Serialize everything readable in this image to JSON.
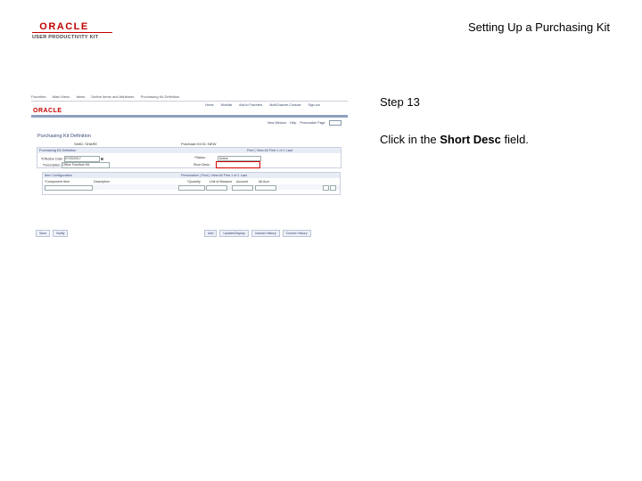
{
  "logo": {
    "brand": "ORACLE",
    "product": "USER PRODUCTIVITY KIT"
  },
  "document": {
    "title": "Setting Up a Purchasing Kit"
  },
  "step": {
    "label": "Step 13",
    "instruction_prefix": "Click in the ",
    "instruction_target": "Short Desc",
    "instruction_suffix": " field."
  },
  "app": {
    "breadcrumbs": [
      "Favorites",
      "Main Menu",
      "Items",
      "Define Items and Attributes",
      "Purchasing Kit Definition"
    ],
    "brand": "ORACLE",
    "top_nav": [
      "Home",
      "Worklist",
      "Add to Favorites",
      "MultiChannel Console",
      "Sign out"
    ],
    "new_window": "New Window",
    "help": "Help",
    "personalize": "Personalize Page",
    "page_title": "Purchasing Kit Definition",
    "setid_label": "SetID:",
    "setid_value": "SHARE",
    "kitid_label": "Purchase Kit ID:",
    "kitid_value": "NEW",
    "panel_title": "Purchasing Kit Definition",
    "panel_nav": "Find | View All   First 1 of 1 Last",
    "effdate_label": "*Effective Date:",
    "effdate_value": "07/03/2017",
    "status_label": "*Status:",
    "status_value": "Active",
    "desc_label": "*Description:",
    "desc_value": "Office Furniture Kit",
    "shortdesc_label": "Short Desc:",
    "grid_title": "Item Configuration",
    "grid_nav": "Personalize | Find | View All   First 1 of 1 Last",
    "grid_columns": [
      "*Component Item",
      "Description",
      "*Quantity",
      "Unit of Measure",
      "Account",
      "Alt Acct"
    ],
    "buttons_left": [
      "Save",
      "Notify"
    ],
    "buttons_right": [
      "Add",
      "Update/Display",
      "Include History",
      "Correct History"
    ]
  },
  "colors": {
    "brand_red": "#c00000",
    "highlight": "#d40000"
  }
}
